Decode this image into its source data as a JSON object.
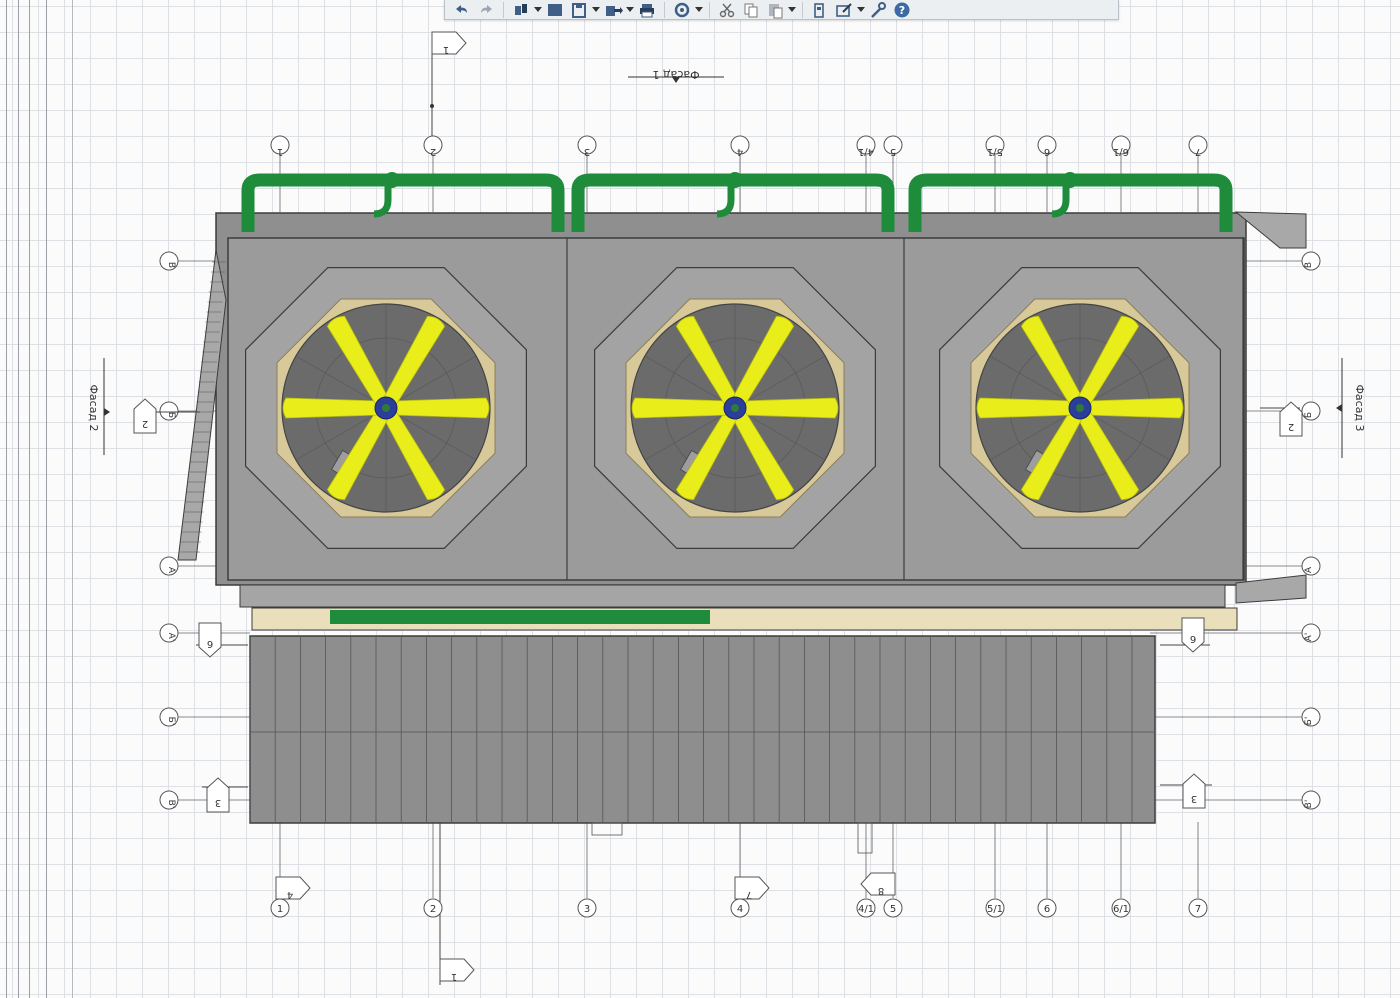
{
  "toolbar": {
    "buttons": [
      {
        "name": "undo-button",
        "icon": "undo-icon"
      },
      {
        "name": "redo-button",
        "icon": "redo-icon"
      },
      {
        "name": "views-button",
        "icon": "views-icon"
      },
      {
        "name": "display-style-button",
        "icon": "display-style-icon"
      },
      {
        "name": "save-button",
        "icon": "save-icon"
      },
      {
        "name": "export-button",
        "icon": "export-icon"
      },
      {
        "name": "print-button",
        "icon": "print-icon"
      },
      {
        "name": "rotate-button",
        "icon": "rotate-icon"
      },
      {
        "name": "cut-button",
        "icon": "scissors-icon"
      },
      {
        "name": "copy-button",
        "icon": "copy-icon"
      },
      {
        "name": "paste-button",
        "icon": "paste-icon"
      },
      {
        "name": "settings-button",
        "icon": "settings-icon"
      },
      {
        "name": "options-button",
        "icon": "options-icon"
      },
      {
        "name": "tools-button",
        "icon": "wrench-icon"
      },
      {
        "name": "help-button",
        "icon": "help-icon"
      }
    ],
    "colors": {
      "icon": "#3f5f86",
      "icon_dark": "#2a3d57",
      "help": "#3b6aa4"
    }
  },
  "drawing": {
    "facade_labels": {
      "top": "Фасад 1",
      "left": "Фасад 2",
      "right": "Фасад 3"
    },
    "section_tags": {
      "top": "1",
      "bottom": "1",
      "left": "2",
      "right": "2",
      "mid_left": "6",
      "mid_right": "6",
      "low_left": "3",
      "low_right": "3",
      "bottom_a": "4",
      "bottom_b": "7",
      "bottom_c": "8"
    },
    "grid_top": [
      "1",
      "2",
      "3",
      "4",
      "4/1",
      "5",
      "5/1",
      "6",
      "6/1",
      "7"
    ],
    "grid_bottom": [
      "1",
      "2",
      "3",
      "4",
      "4/1",
      "5",
      "5/1",
      "6",
      "6/1",
      "7"
    ],
    "grid_left": [
      "В",
      "Б",
      "А",
      "А'",
      "Б'",
      "В'"
    ],
    "grid_right": [
      "В",
      "Б",
      "А",
      "А'",
      "Б'",
      "В'"
    ],
    "colors": {
      "roof": "#9b9b9b",
      "pipe": "#1e8c3a",
      "blade": "#e9ee1a",
      "ring": "#d8c99a",
      "hub": "#2b3e9a",
      "line": "#3c3c3c",
      "grid": "#dde1e6"
    },
    "fans": 3,
    "blades_per_fan": 6
  }
}
